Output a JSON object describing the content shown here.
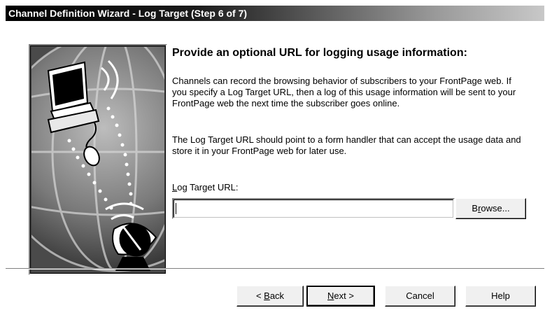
{
  "window": {
    "title": "Channel Definition Wizard - Log Target (Step 6 of 7)"
  },
  "content": {
    "heading": "Provide an optional URL for logging usage information:",
    "paragraph1": "Channels can record the browsing behavior of subscribers to your FrontPage web.  If you specify a Log Target URL, then a log of this usage information will be sent to your FrontPage web the next time the subscriber goes online.",
    "paragraph2": "The Log Target URL should point to a form handler that can accept the usage data and store it in your FrontPage web for later use.",
    "field_label_access": "L",
    "field_label_rest": "og Target URL:",
    "url_value": ""
  },
  "buttons": {
    "browse_pre": "B",
    "browse_access": "r",
    "browse_post": "owse...",
    "back_pre": "< ",
    "back_access": "B",
    "back_post": "ack",
    "next_access": "N",
    "next_post": "ext >",
    "cancel": "Cancel",
    "help": "Help"
  },
  "icons": {
    "illustration": "channel-globe-computer-satellite-illustration"
  }
}
